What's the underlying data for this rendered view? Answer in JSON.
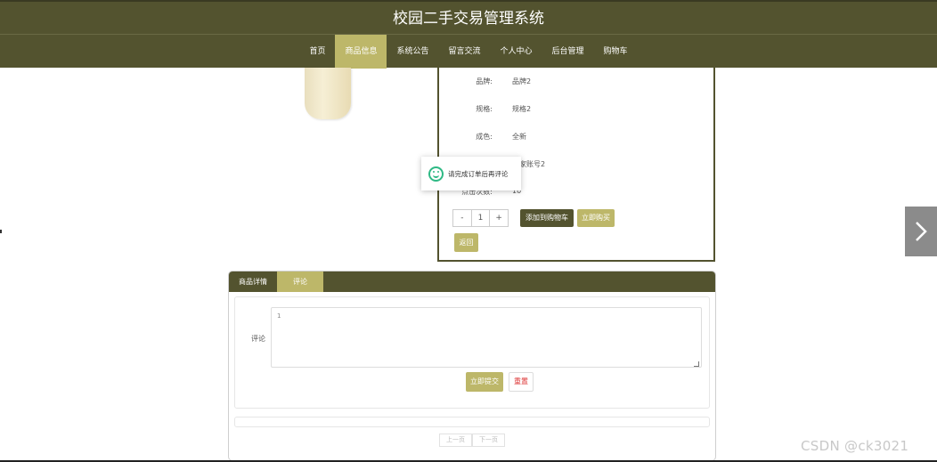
{
  "header": {
    "title": "校园二手交易管理系统"
  },
  "nav": {
    "items": [
      {
        "label": "首页",
        "active": false
      },
      {
        "label": "商品信息",
        "active": true
      },
      {
        "label": "系统公告",
        "active": false
      },
      {
        "label": "留言交流",
        "active": false
      },
      {
        "label": "个人中心",
        "active": false
      },
      {
        "label": "后台管理",
        "active": false
      },
      {
        "label": "购物车",
        "active": false
      }
    ]
  },
  "product": {
    "fields": [
      {
        "label": "品牌:",
        "value": "品牌2"
      },
      {
        "label": "规格:",
        "value": "规格2"
      },
      {
        "label": "成色:",
        "value": "全新"
      },
      {
        "label": "",
        "value": "卖家账号2"
      },
      {
        "label": "点击次数:",
        "value": "10"
      }
    ],
    "quantity": {
      "minus": "-",
      "value": "1",
      "plus": "+"
    },
    "add_to_cart_label": "添加到购物车",
    "buy_now_label": "立即购买",
    "back_label": "返回"
  },
  "toast": {
    "message": "请完成订单后再评论"
  },
  "tabs": [
    {
      "label": "商品详情",
      "active": false
    },
    {
      "label": "评论",
      "active": true
    }
  ],
  "comment_form": {
    "label": "评论",
    "textarea_value": "1",
    "submit_label": "立即提交",
    "reset_label": "重置"
  },
  "pager": {
    "prev_label": "上一页",
    "next_label": "下一页"
  },
  "watermark": "CSDN @ck3021",
  "colors": {
    "primary": "#53532f",
    "accent": "#bdb769",
    "success": "#2fb985"
  }
}
